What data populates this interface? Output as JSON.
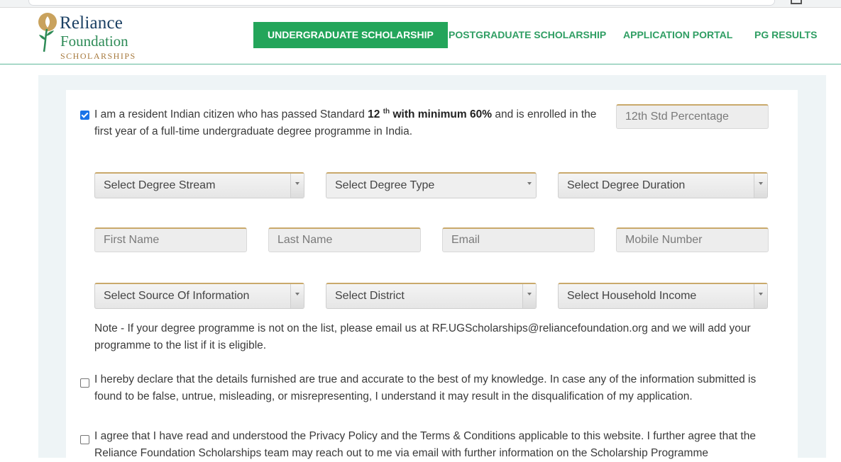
{
  "logo": {
    "line1": "Reliance",
    "line2": "Foundation",
    "line3": "SCHOLARSHIPS"
  },
  "nav": {
    "items": [
      {
        "label": "UNDERGRADUATE SCHOLARSHIP",
        "active": true
      },
      {
        "label": "POSTGRADUATE SCHOLARSHIP"
      },
      {
        "label": "APPLICATION PORTAL"
      },
      {
        "label": "PG RESULTS"
      }
    ]
  },
  "form": {
    "eligibility": {
      "checked": true,
      "text_a": "I am a resident Indian citizen who has passed Standard ",
      "bold_12": "12",
      "sup": "th",
      "bold_min": " with minimum 60%",
      "text_b": " and is enrolled in the first year of a full-time undergraduate degree programme in India."
    },
    "percentage_placeholder": "12th Std Percentage",
    "selects_row1": {
      "stream": "Select Degree Stream",
      "type": "Select Degree Type",
      "duration": "Select Degree Duration"
    },
    "inputs": {
      "first_name": "First Name",
      "last_name": "Last Name",
      "email": "Email",
      "mobile": "Mobile Number"
    },
    "selects_row3": {
      "source": "Select Source Of Information",
      "district": "Select District",
      "income": "Select Household Income"
    },
    "note": "Note - If your degree programme is not on the list, please email us at RF.UGScholarships@reliancefoundation.org and we will add your programme to the list if it is eligible.",
    "declaration": "I hereby declare that the details furnished are true and accurate to the best of my knowledge. In case any of the information submitted is found to be false, untrue, misleading, or misrepresenting, I understand it may result in the disqualification of my application.",
    "privacy": "I agree that I have read and understood the Privacy Policy and the Terms & Conditions applicable to this website. I further agree that the Reliance Foundation Scholarships team may reach out to me via email with further information on the Scholarship Programme"
  },
  "colors": {
    "accent": "#23a55a",
    "nav_text": "#2f9e63",
    "field_border_top": "#c9a96b"
  }
}
